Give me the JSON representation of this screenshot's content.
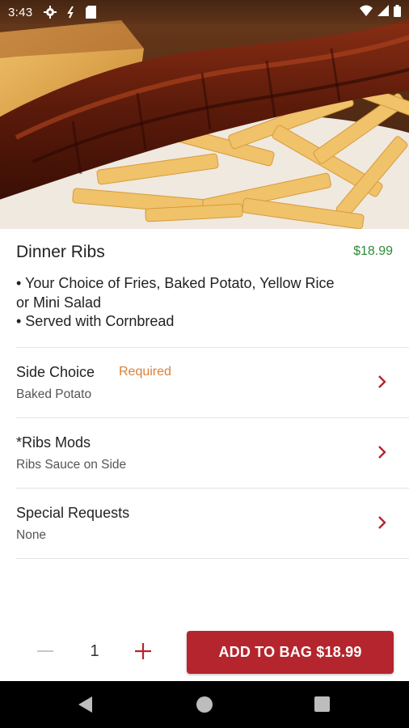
{
  "status_bar": {
    "time": "3:43",
    "left_icons": [
      "gear-icon",
      "sync-icon",
      "sd-card-icon"
    ],
    "right_icons": [
      "wifi-icon",
      "cell-signal-icon",
      "battery-icon"
    ]
  },
  "item": {
    "title": "Dinner Ribs",
    "price": "$18.99",
    "description_lines": [
      "• Your Choice of Fries, Baked Potato, Yellow Rice",
      "or Mini Salad",
      "• Served with Cornbread"
    ]
  },
  "options": [
    {
      "title": "Side Choice",
      "badge": "Required",
      "value": "Baked Potato"
    },
    {
      "title": "*Ribs Mods",
      "badge": "",
      "value": "Ribs Sauce on Side"
    },
    {
      "title": "Special Requests",
      "badge": "",
      "value": "None"
    }
  ],
  "quantity": {
    "value": "1"
  },
  "add_button": {
    "label": "ADD TO BAG $18.99"
  },
  "colors": {
    "accent": "#b5252d",
    "price": "#2e8b3a",
    "required": "#d8823a"
  },
  "nav": {
    "icons": [
      "back-icon",
      "home-icon",
      "recents-icon"
    ]
  }
}
